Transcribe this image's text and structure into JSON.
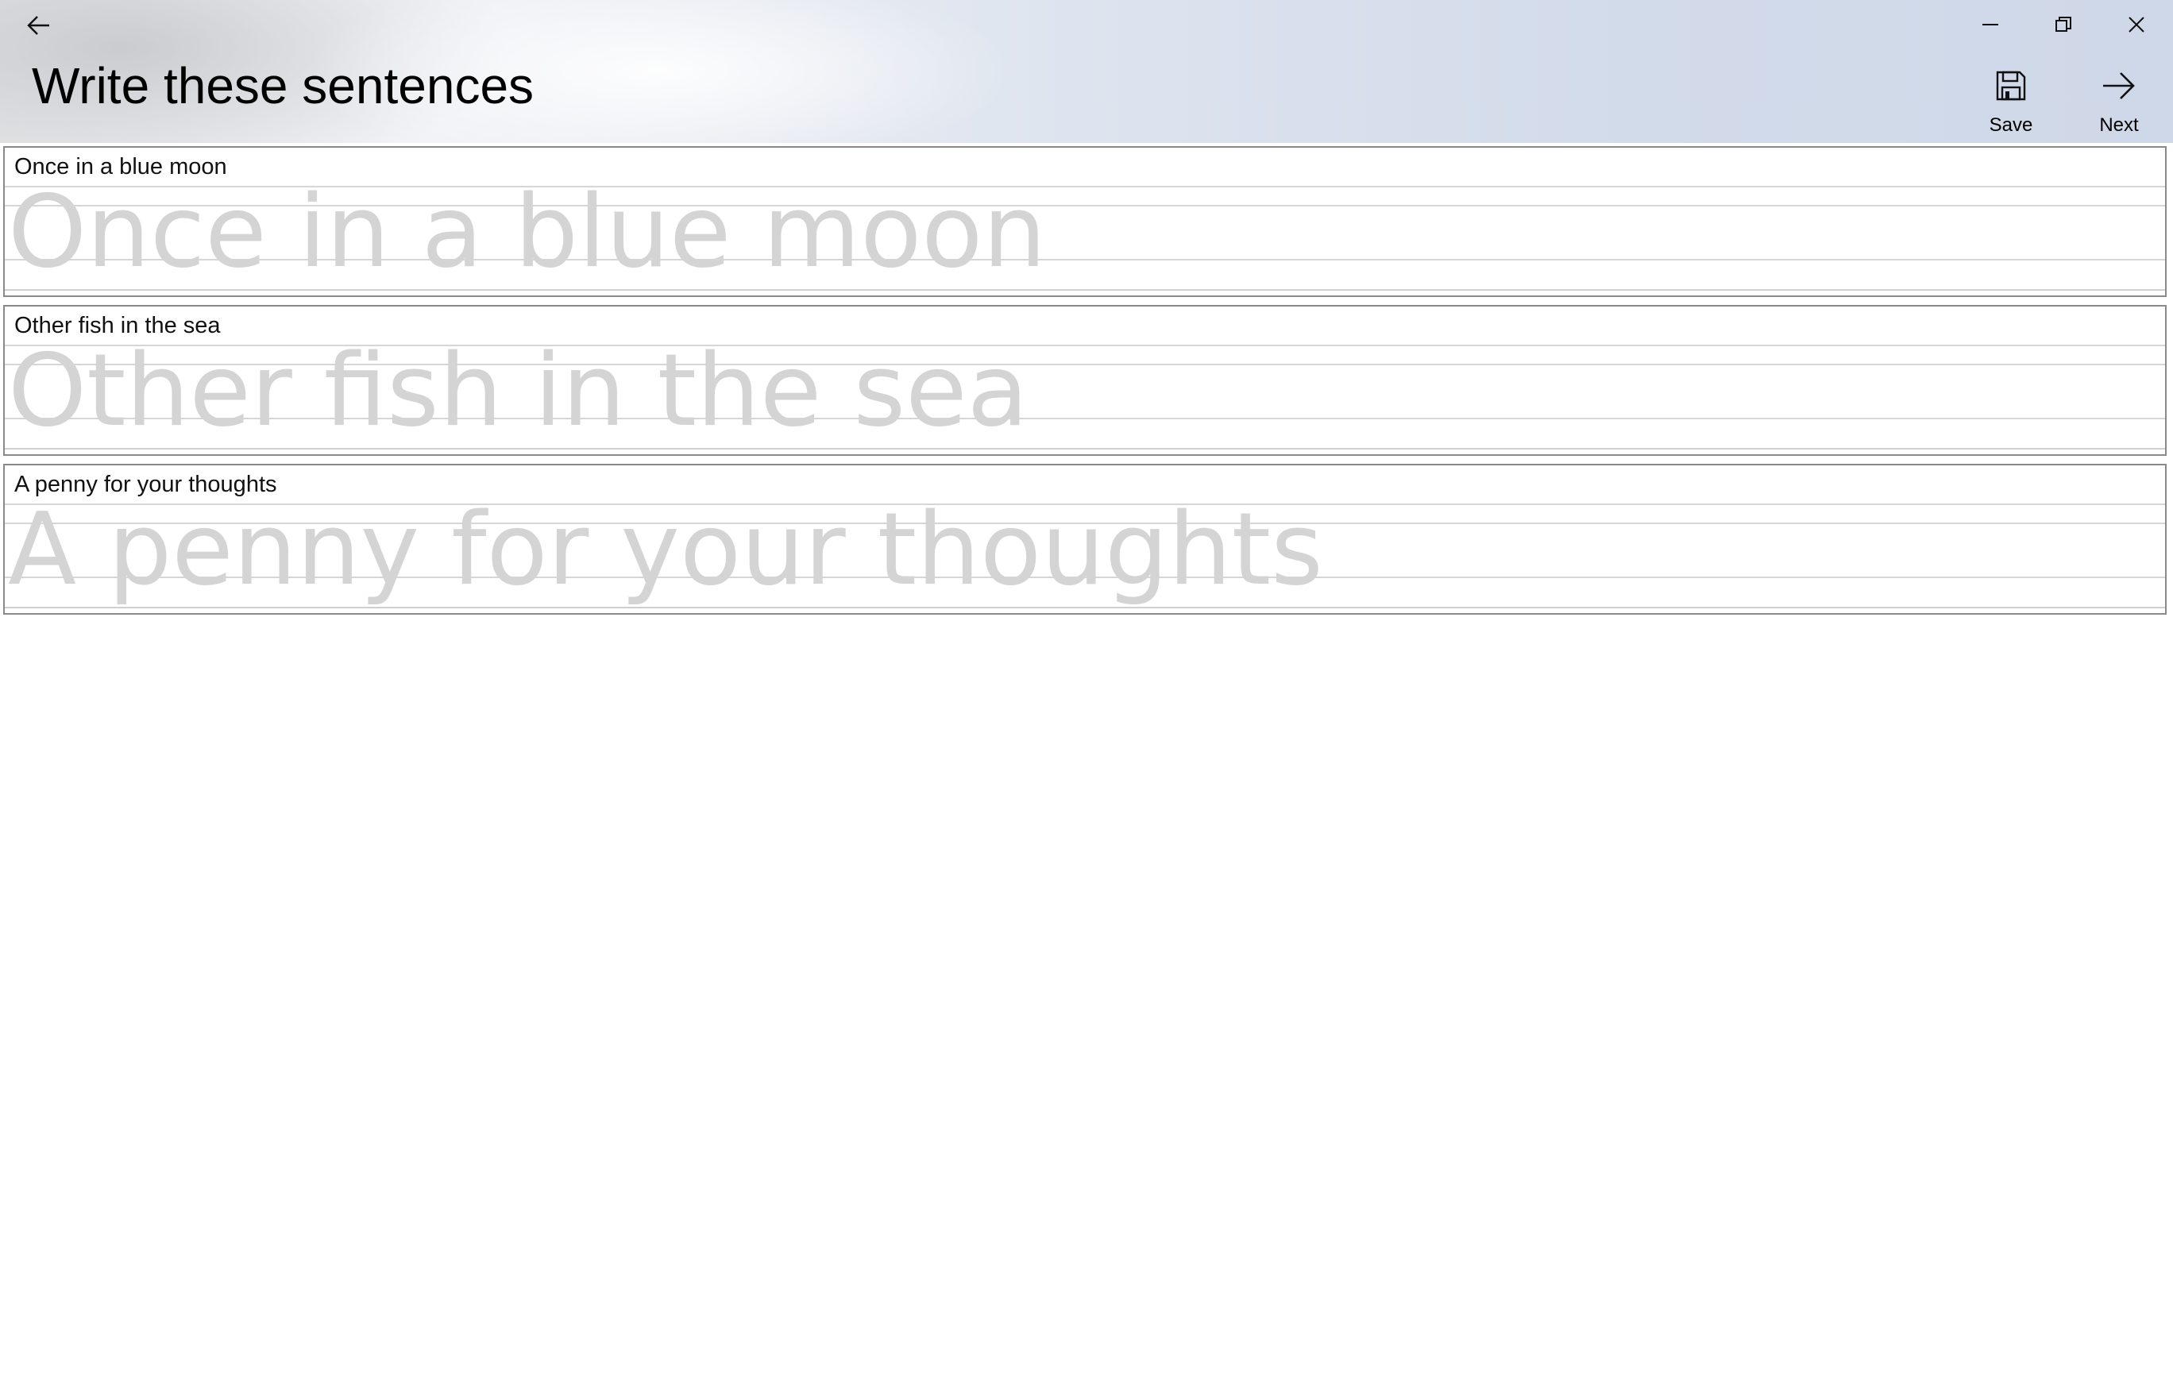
{
  "window": {
    "title": "Write these sentences"
  },
  "icons": {
    "back": "back-arrow-icon",
    "minimize": "minimize-icon",
    "maximize": "restore-icon",
    "close": "close-icon",
    "save": "floppy-disk-icon",
    "next": "arrow-right-icon"
  },
  "commands": {
    "save_label": "Save",
    "next_label": "Next"
  },
  "sentences": [
    {
      "prompt": "Once in a blue moon",
      "trace": "Once in a blue moon"
    },
    {
      "prompt": "Other fish in the sea",
      "trace": "Other fish in the sea"
    },
    {
      "prompt": "A penny for your thoughts",
      "trace": "A penny for your thoughts"
    }
  ],
  "colors": {
    "trace_text": "#d4d4d4",
    "guide_line": "#d6d6d6",
    "card_border": "#8a8a8a"
  }
}
